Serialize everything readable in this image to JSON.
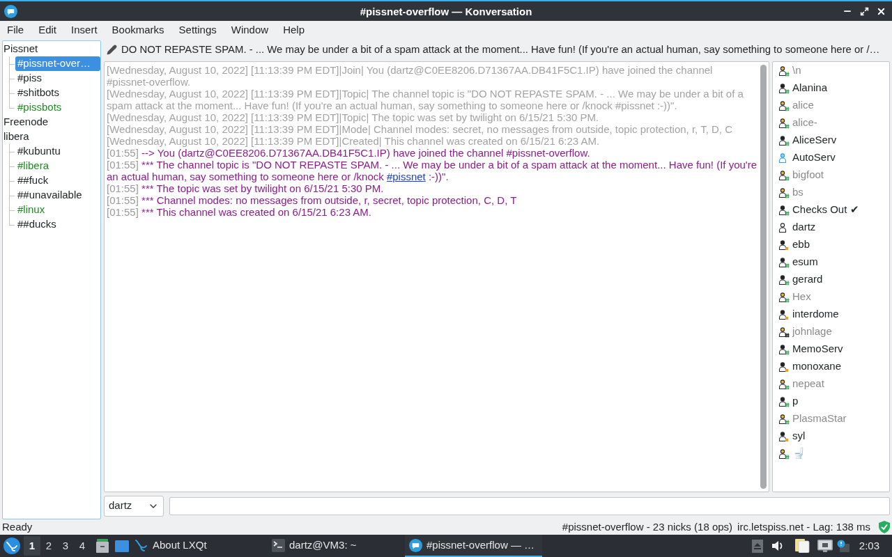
{
  "window": {
    "title": "#pissnet-overflow — Konversation"
  },
  "menu": [
    "File",
    "Edit",
    "Insert",
    "Bookmarks",
    "Settings",
    "Window",
    "Help"
  ],
  "servers": [
    {
      "name": "Pissnet",
      "selected": false,
      "children": [
        {
          "name": "#pissnet-over…",
          "selected": true,
          "activity": false
        },
        {
          "name": "#piss",
          "selected": false,
          "activity": false
        },
        {
          "name": "#shitbots",
          "selected": false,
          "activity": false
        },
        {
          "name": "#pissbots",
          "selected": false,
          "activity": true
        }
      ]
    },
    {
      "name": "Freenode",
      "selected": false
    },
    {
      "name": "libera",
      "selected": false,
      "children": [
        {
          "name": "#kubuntu",
          "selected": false,
          "activity": false
        },
        {
          "name": "#libera",
          "selected": false,
          "activity": true
        },
        {
          "name": "##fuck",
          "selected": false,
          "activity": false
        },
        {
          "name": "##unavailable",
          "selected": false,
          "activity": false
        },
        {
          "name": "#linux",
          "selected": false,
          "activity": true
        },
        {
          "name": "##ducks",
          "selected": false,
          "activity": false
        }
      ]
    }
  ],
  "topic": "DO NOT REPASTE SPAM. - ... We may be under a bit of a spam attack at the moment... Have fun! (If you're an actual human, say something to someone here or /…",
  "chat": [
    {
      "kind": "backlog",
      "text": "[Wednesday, August 10, 2022] [11:13:39 PM EDT]|Join| You (dartz@C0EE8206.D71367AA.DB41F5C1.IP) have joined the channel #pissnet-overflow."
    },
    {
      "kind": "backlog",
      "text": "[Wednesday, August 10, 2022] [11:13:39 PM EDT]|Topic| The channel topic is \"DO NOT REPASTE SPAM. - ... We may be under a bit of a spam attack at the moment... Have fun! (If you're an actual human, say something to someone here or /knock #pissnet :-))\"."
    },
    {
      "kind": "backlog",
      "text": "[Wednesday, August 10, 2022] [11:13:39 PM EDT]|Topic| The topic was set by twilight on 6/15/21 5:30 PM."
    },
    {
      "kind": "backlog",
      "text": "[Wednesday, August 10, 2022] [11:13:39 PM EDT]|Mode| Channel modes: secret, no messages from outside, topic protection, r, T, D, C"
    },
    {
      "kind": "backlog",
      "text": "[Wednesday, August 10, 2022] [11:13:39 PM EDT]|Created| This channel was created on 6/15/21 6:23 AM."
    },
    {
      "kind": "event",
      "timestamp": "[01:55]",
      "text": "--> You (dartz@C0EE8206.D71367AA.DB41F5C1.IP) have joined the channel #pissnet-overflow."
    },
    {
      "kind": "event",
      "timestamp": "[01:55]",
      "text": "*** The channel topic is \"DO NOT REPASTE SPAM. - ... We may be under a bit of a spam attack at the moment... Have fun! (If you're an actual human, say something to someone here or /knock",
      "link": "#pissnet",
      "text_after": ":-))\"."
    },
    {
      "kind": "event",
      "timestamp": "[01:55]",
      "text": "*** The topic was set by twilight on 6/15/21 5:30 PM."
    },
    {
      "kind": "event",
      "timestamp": "[01:55]",
      "text": "*** Channel modes: no messages from outside, r, secret, topic protection, C, D, T"
    },
    {
      "kind": "event",
      "timestamp": "[01:55]",
      "text": "*** This channel was created on 6/15/21 6:23 AM."
    }
  ],
  "nicks": [
    {
      "name": "\\n",
      "kind": "op",
      "away": true
    },
    {
      "name": "Alanina",
      "kind": "op",
      "away": false
    },
    {
      "name": "alice",
      "kind": "op",
      "away": true
    },
    {
      "name": "alice-",
      "kind": "op",
      "away": true
    },
    {
      "name": "AliceServ",
      "kind": "op",
      "away": false
    },
    {
      "name": "AutoServ",
      "kind": "admin",
      "away": false
    },
    {
      "name": "bigfoot",
      "kind": "op",
      "away": true
    },
    {
      "name": "bs",
      "kind": "op",
      "away": true
    },
    {
      "name": "Checks Out ✔",
      "kind": "op",
      "away": false
    },
    {
      "name": "dartz",
      "kind": "plain",
      "away": false
    },
    {
      "name": "ebb",
      "kind": "voice",
      "away": false
    },
    {
      "name": "esum",
      "kind": "op",
      "away": false
    },
    {
      "name": "gerard",
      "kind": "op",
      "away": false
    },
    {
      "name": "Hex",
      "kind": "op",
      "away": true
    },
    {
      "name": "interdome",
      "kind": "voice",
      "away": false
    },
    {
      "name": "johnlage",
      "kind": "owner",
      "away": true
    },
    {
      "name": "MemoServ",
      "kind": "op",
      "away": false
    },
    {
      "name": "monoxane",
      "kind": "voice",
      "away": false
    },
    {
      "name": "nepeat",
      "kind": "op",
      "away": true
    },
    {
      "name": "p",
      "kind": "op",
      "away": false
    },
    {
      "name": "PlasmaStar",
      "kind": "op",
      "away": true
    },
    {
      "name": "syl",
      "kind": "voice",
      "away": false
    },
    {
      "name": "🚽",
      "kind": "op",
      "away": true
    }
  ],
  "input": {
    "nickname": "dartz"
  },
  "status_bar": {
    "message": "Ready",
    "channel_info": "#pissnet-overflow - 23 nicks (18 ops)",
    "server_info": "irc.letspiss.net - Lag: 138 ms"
  },
  "taskbar": {
    "desktops": [
      {
        "label": "1",
        "selected": true
      },
      {
        "label": "2",
        "selected": false
      },
      {
        "label": "3",
        "selected": false
      },
      {
        "label": "4",
        "selected": false
      }
    ],
    "tasks": [
      {
        "kind": "about",
        "label": "About LXQt",
        "selected": false
      },
      {
        "kind": "terminal",
        "label": "dartz@VM3: ~",
        "selected": false
      },
      {
        "kind": "chat",
        "label": "#pissnet-overflow — …",
        "selected": true
      }
    ],
    "clock": "2:03"
  }
}
